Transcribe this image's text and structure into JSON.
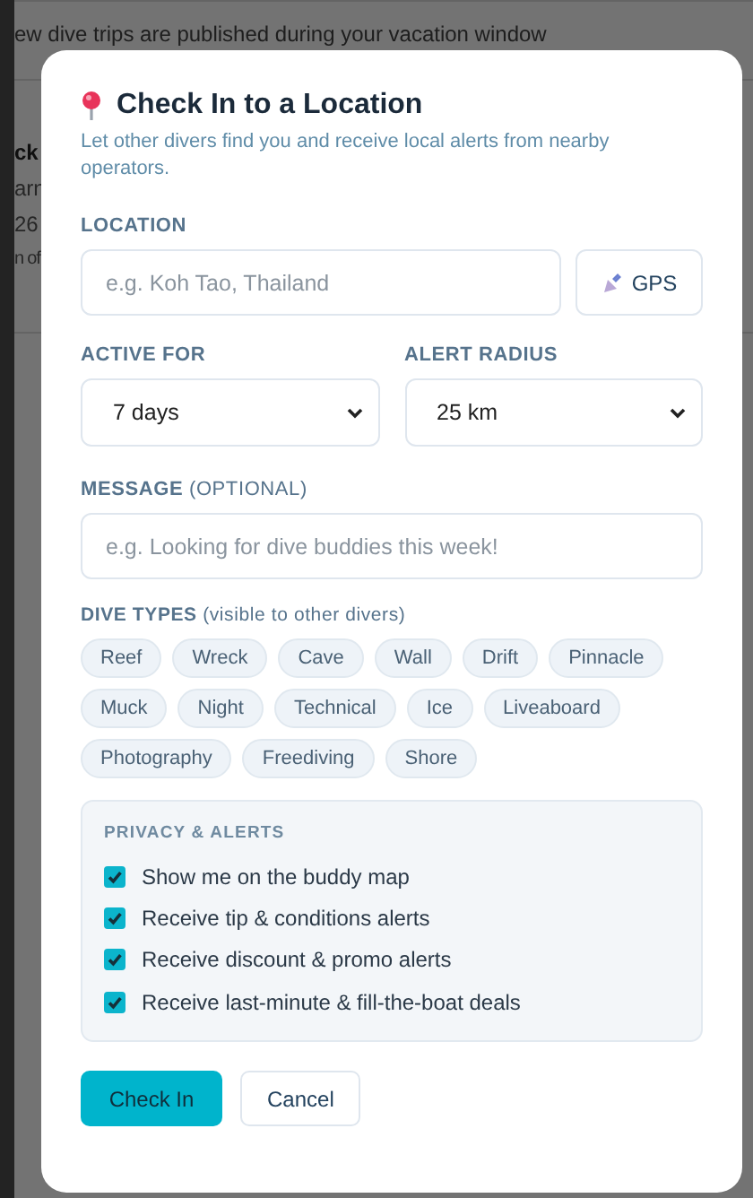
{
  "background_page": {
    "notice": "ew dive trips are published during your vacation window",
    "card_lines": [
      "ck",
      "arn",
      "26",
      "n of"
    ]
  },
  "dialog": {
    "title": "Check In to a Location",
    "subtitle": "Let other divers find you and receive local alerts from nearby operators.",
    "location": {
      "label": "LOCATION",
      "placeholder": "e.g. Koh Tao, Thailand",
      "gps_button": "GPS"
    },
    "active_for": {
      "label": "ACTIVE FOR",
      "value": "7 days"
    },
    "alert_radius": {
      "label": "ALERT RADIUS",
      "value": "25 km"
    },
    "message": {
      "label": "**MESSAGE** (OPTIONAL)",
      "placeholder": "e.g. Looking for dive buddies this week!"
    },
    "dive_types": {
      "label": "**DIVE TYPES** (visible to other divers)",
      "options": [
        {
          "label": "Reef",
          "selected": false
        },
        {
          "label": "Wreck",
          "selected": false
        },
        {
          "label": "Cave",
          "selected": false
        },
        {
          "label": "Wall",
          "selected": false
        },
        {
          "label": "Drift",
          "selected": false
        },
        {
          "label": "Pinnacle",
          "selected": false
        },
        {
          "label": "Muck",
          "selected": false
        },
        {
          "label": "Night",
          "selected": false
        },
        {
          "label": "Technical",
          "selected": false
        },
        {
          "label": "Ice",
          "selected": false
        },
        {
          "label": "Liveaboard",
          "selected": false
        },
        {
          "label": "Photography",
          "selected": false
        },
        {
          "label": "Freediving",
          "selected": false
        },
        {
          "label": "Shore",
          "selected": false
        }
      ]
    },
    "privacy": {
      "title": "PRIVACY & ALERTS",
      "options": [
        {
          "label": "Show me on the buddy map",
          "checked": true
        },
        {
          "label": "Receive tip & conditions alerts",
          "checked": true
        },
        {
          "label": "Receive discount & promo alerts",
          "checked": true
        },
        {
          "label": "Receive last-minute & fill-the-boat deals",
          "checked": true
        }
      ]
    },
    "buttons": [
      {
        "label": "Check In",
        "kind": "primary"
      },
      {
        "label": "Cancel",
        "kind": "secondary"
      }
    ]
  }
}
